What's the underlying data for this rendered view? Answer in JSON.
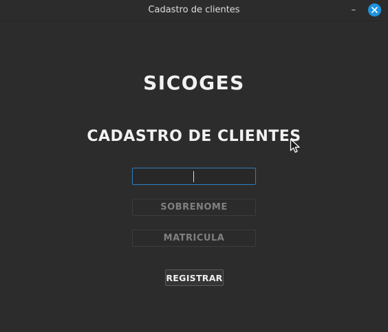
{
  "window": {
    "title": "Cadastro de clientes",
    "minimize_symbol": "–",
    "close_icon": "close-icon",
    "accent_color": "#1e94e0"
  },
  "main": {
    "app_title": "SICOGES",
    "section_title": "CADASTRO DE CLIENTES"
  },
  "form": {
    "name": {
      "value": "",
      "placeholder": ""
    },
    "surname": {
      "value": "",
      "placeholder": "SOBRENOME"
    },
    "registration": {
      "value": "",
      "placeholder": "MATRÍCULA"
    },
    "register_label": "REGISTRAR"
  }
}
